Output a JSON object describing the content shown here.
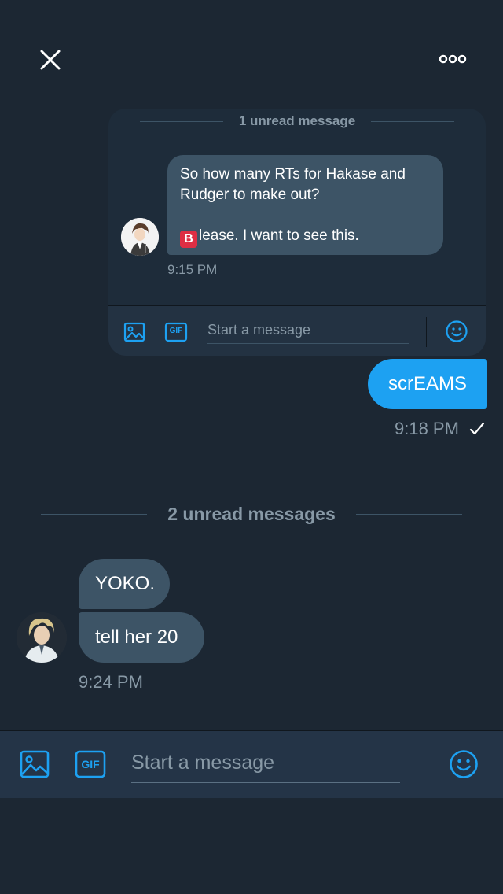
{
  "colors": {
    "background": "#1c2733",
    "accent": "#1da1f2",
    "bubble_incoming": "#3d5466",
    "muted_text": "#8899a6",
    "badge_red": "#dd2e44"
  },
  "header": {
    "close_icon": "close-icon",
    "more_icon": "more-icon"
  },
  "embedded_conversation": {
    "unread_label": "1 unread message",
    "message": {
      "line1": "So how many RTs for Hakase and",
      "line2": "Rudger to make out?",
      "badge": "B",
      "line3": "lease. I want to see this."
    },
    "time": "9:15 PM",
    "composer": {
      "image_icon": "image-icon",
      "gif_label": "GIF",
      "placeholder": "Start a message",
      "emoji_icon": "emoji-icon"
    }
  },
  "outgoing": {
    "text": "scrEAMS",
    "time": "9:18 PM",
    "status_icon": "check-icon"
  },
  "unread_divider": "2 unread messages",
  "incoming": {
    "messages": [
      "YOKO.",
      "tell her 20"
    ],
    "time": "9:24 PM"
  },
  "composer": {
    "image_icon": "image-icon",
    "gif_label": "GIF",
    "placeholder": "Start a message",
    "emoji_icon": "emoji-icon"
  }
}
